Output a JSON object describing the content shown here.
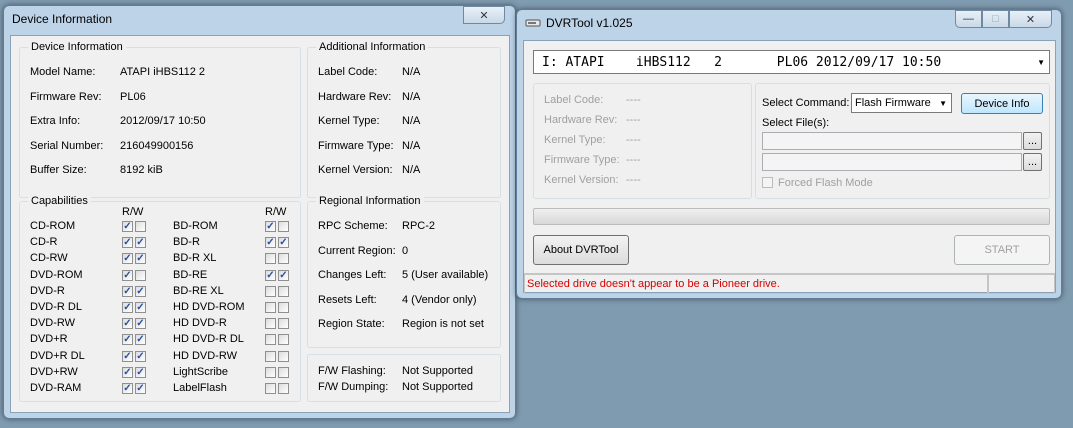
{
  "device_window": {
    "title": "Device Information",
    "close_glyph": "✕",
    "device_info": {
      "heading": "Device Information",
      "rows": [
        {
          "label": "Model Name:",
          "value": "ATAPI    iHBS112  2"
        },
        {
          "label": "Firmware Rev:",
          "value": "PL06"
        },
        {
          "label": "Extra Info:",
          "value": "2012/09/17 10:50"
        },
        {
          "label": "Serial Number:",
          "value": "216049900156"
        },
        {
          "label": "Buffer Size:",
          "value": "8192 kiB"
        }
      ]
    },
    "additional_info": {
      "heading": "Additional Information",
      "rows": [
        {
          "label": "Label Code:",
          "value": "N/A"
        },
        {
          "label": "Hardware Rev:",
          "value": "N/A"
        },
        {
          "label": "Kernel Type:",
          "value": "N/A"
        },
        {
          "label": "Firmware Type:",
          "value": "N/A"
        },
        {
          "label": "Kernel Version:",
          "value": "N/A"
        }
      ]
    },
    "capabilities": {
      "heading": "Capabilities",
      "rw_header": "R/W",
      "left": [
        {
          "label": "CD-ROM",
          "r": true,
          "w": false
        },
        {
          "label": "CD-R",
          "r": true,
          "w": true
        },
        {
          "label": "CD-RW",
          "r": true,
          "w": true
        },
        {
          "label": "DVD-ROM",
          "r": true,
          "w": false
        },
        {
          "label": "DVD-R",
          "r": true,
          "w": true
        },
        {
          "label": "DVD-R DL",
          "r": true,
          "w": true
        },
        {
          "label": "DVD-RW",
          "r": true,
          "w": true
        },
        {
          "label": "DVD+R",
          "r": true,
          "w": true
        },
        {
          "label": "DVD+R DL",
          "r": true,
          "w": true
        },
        {
          "label": "DVD+RW",
          "r": true,
          "w": true
        },
        {
          "label": "DVD-RAM",
          "r": true,
          "w": true
        }
      ],
      "right": [
        {
          "label": "BD-ROM",
          "r": true,
          "w": false
        },
        {
          "label": "BD-R",
          "r": true,
          "w": true
        },
        {
          "label": "BD-R XL",
          "r": false,
          "w": false
        },
        {
          "label": "BD-RE",
          "r": true,
          "w": true
        },
        {
          "label": "BD-RE XL",
          "r": false,
          "w": false
        },
        {
          "label": "HD DVD-ROM",
          "r": false,
          "w": false
        },
        {
          "label": "HD DVD-R",
          "r": false,
          "w": false
        },
        {
          "label": "HD DVD-R DL",
          "r": false,
          "w": false
        },
        {
          "label": "HD DVD-RW",
          "r": false,
          "w": false
        },
        {
          "label": "LightScribe",
          "r": false,
          "w": false
        },
        {
          "label": "LabelFlash",
          "r": false,
          "w": false
        }
      ]
    },
    "regional_info": {
      "heading": "Regional Information",
      "rows": [
        {
          "label": "RPC Scheme:",
          "value": "RPC-2"
        },
        {
          "label": "Current Region:",
          "value": "0"
        },
        {
          "label": "Changes Left:",
          "value": "5 (User available)"
        },
        {
          "label": "Resets Left:",
          "value": "4 (Vendor only)"
        },
        {
          "label": "Region State:",
          "value": "Region is not set"
        }
      ]
    },
    "fw_info": {
      "rows": [
        {
          "label": "F/W Flashing:",
          "value": "Not Supported"
        },
        {
          "label": "F/W Dumping:",
          "value": "Not Supported"
        }
      ]
    }
  },
  "dvrtool_window": {
    "title": "DVRTool v1.025",
    "icon": "drive-icon",
    "min_glyph": "—",
    "max_glyph": "□",
    "close_glyph": "✕",
    "drive_select": {
      "value": "I: ATAPI    iHBS112   2       PL06 2012/09/17 10:50"
    },
    "info_labels": [
      {
        "label": "Label Code:",
        "value": "----"
      },
      {
        "label": "Hardware Rev:",
        "value": "----"
      },
      {
        "label": "Kernel Type:",
        "value": "----"
      },
      {
        "label": "Firmware Type:",
        "value": "----"
      },
      {
        "label": "Kernel Version:",
        "value": "----"
      }
    ],
    "select_command_label": "Select Command:",
    "command_value": "Flash Firmware",
    "device_info_button": "Device Info",
    "select_files_label": "Select File(s):",
    "browse_label": "...",
    "forced_flash_label": "Forced Flash Mode",
    "progress": 0,
    "about_button": "About DVRTool",
    "start_button": "START",
    "status_text": "Selected drive doesn't appear to be a Pioneer drive.",
    "status_color": "#d40000"
  }
}
